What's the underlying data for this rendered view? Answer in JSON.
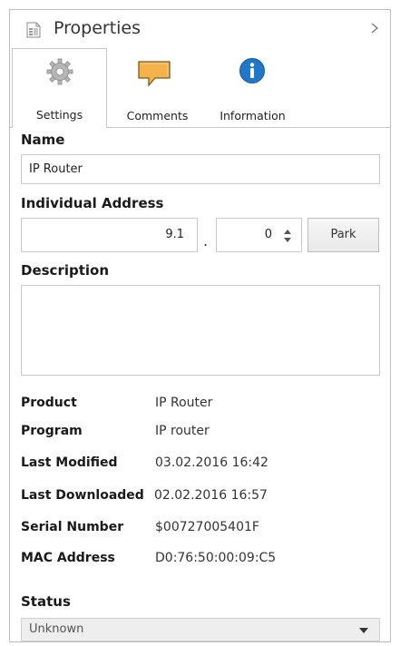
{
  "header": {
    "title": "Properties",
    "collapse_icon": "chevron-right-icon",
    "doc_icon": "document-icon"
  },
  "tabs": [
    {
      "label": "Settings",
      "icon": "gear-icon",
      "active": true
    },
    {
      "label": "Comments",
      "icon": "comment-icon",
      "active": false
    },
    {
      "label": "Information",
      "icon": "info-icon",
      "active": false
    }
  ],
  "name": {
    "label": "Name",
    "value": "IP Router"
  },
  "individual_address": {
    "label": "Individual Address",
    "area_line": "9.1",
    "separator": ".",
    "device": "0",
    "park_label": "Park"
  },
  "description": {
    "label": "Description",
    "value": ""
  },
  "info": [
    {
      "key": "Product",
      "value": "IP Router"
    },
    {
      "key": "Program",
      "value": "IP router"
    },
    {
      "key": "Last Modified",
      "value": "03.02.2016 16:42"
    },
    {
      "key": "Last Downloaded",
      "value": "02.02.2016 16:57"
    },
    {
      "key": "Serial Number",
      "value": "$00727005401F"
    },
    {
      "key": "MAC Address",
      "value": "D0:76:50:00:09:C5"
    }
  ],
  "status": {
    "label": "Status",
    "value": "Unknown"
  },
  "colors": {
    "info_blue": "#1f78c8",
    "comment_orange": "#f3b24a",
    "border": "#c9c9c9"
  }
}
